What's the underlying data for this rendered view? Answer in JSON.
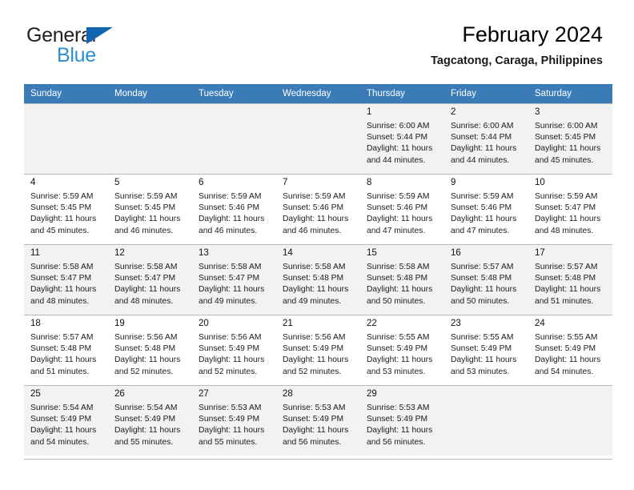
{
  "brand": {
    "name_top": "General",
    "name_bottom": "Blue",
    "triangle_color": "#1266b0",
    "bottom_text_color": "#2a8fd4"
  },
  "header": {
    "title": "February 2024",
    "location": "Tagcatong, Caraga, Philippines"
  },
  "theme": {
    "header_row_bg": "#3b7cb8",
    "header_row_text": "#ffffff",
    "shaded_row_bg": "#f2f2f2",
    "grid_line": "#b9b9b9"
  },
  "weekday_headers": [
    "Sunday",
    "Monday",
    "Tuesday",
    "Wednesday",
    "Thursday",
    "Friday",
    "Saturday"
  ],
  "weeks": [
    {
      "shaded": true,
      "days": [
        {
          "day": "",
          "lines": []
        },
        {
          "day": "",
          "lines": []
        },
        {
          "day": "",
          "lines": []
        },
        {
          "day": "",
          "lines": []
        },
        {
          "day": "1",
          "lines": [
            "Sunrise: 6:00 AM",
            "Sunset: 5:44 PM",
            "Daylight: 11 hours",
            "and 44 minutes."
          ]
        },
        {
          "day": "2",
          "lines": [
            "Sunrise: 6:00 AM",
            "Sunset: 5:44 PM",
            "Daylight: 11 hours",
            "and 44 minutes."
          ]
        },
        {
          "day": "3",
          "lines": [
            "Sunrise: 6:00 AM",
            "Sunset: 5:45 PM",
            "Daylight: 11 hours",
            "and 45 minutes."
          ]
        }
      ]
    },
    {
      "shaded": false,
      "days": [
        {
          "day": "4",
          "lines": [
            "Sunrise: 5:59 AM",
            "Sunset: 5:45 PM",
            "Daylight: 11 hours",
            "and 45 minutes."
          ]
        },
        {
          "day": "5",
          "lines": [
            "Sunrise: 5:59 AM",
            "Sunset: 5:45 PM",
            "Daylight: 11 hours",
            "and 46 minutes."
          ]
        },
        {
          "day": "6",
          "lines": [
            "Sunrise: 5:59 AM",
            "Sunset: 5:46 PM",
            "Daylight: 11 hours",
            "and 46 minutes."
          ]
        },
        {
          "day": "7",
          "lines": [
            "Sunrise: 5:59 AM",
            "Sunset: 5:46 PM",
            "Daylight: 11 hours",
            "and 46 minutes."
          ]
        },
        {
          "day": "8",
          "lines": [
            "Sunrise: 5:59 AM",
            "Sunset: 5:46 PM",
            "Daylight: 11 hours",
            "and 47 minutes."
          ]
        },
        {
          "day": "9",
          "lines": [
            "Sunrise: 5:59 AM",
            "Sunset: 5:46 PM",
            "Daylight: 11 hours",
            "and 47 minutes."
          ]
        },
        {
          "day": "10",
          "lines": [
            "Sunrise: 5:59 AM",
            "Sunset: 5:47 PM",
            "Daylight: 11 hours",
            "and 48 minutes."
          ]
        }
      ]
    },
    {
      "shaded": true,
      "days": [
        {
          "day": "11",
          "lines": [
            "Sunrise: 5:58 AM",
            "Sunset: 5:47 PM",
            "Daylight: 11 hours",
            "and 48 minutes."
          ]
        },
        {
          "day": "12",
          "lines": [
            "Sunrise: 5:58 AM",
            "Sunset: 5:47 PM",
            "Daylight: 11 hours",
            "and 48 minutes."
          ]
        },
        {
          "day": "13",
          "lines": [
            "Sunrise: 5:58 AM",
            "Sunset: 5:47 PM",
            "Daylight: 11 hours",
            "and 49 minutes."
          ]
        },
        {
          "day": "14",
          "lines": [
            "Sunrise: 5:58 AM",
            "Sunset: 5:48 PM",
            "Daylight: 11 hours",
            "and 49 minutes."
          ]
        },
        {
          "day": "15",
          "lines": [
            "Sunrise: 5:58 AM",
            "Sunset: 5:48 PM",
            "Daylight: 11 hours",
            "and 50 minutes."
          ]
        },
        {
          "day": "16",
          "lines": [
            "Sunrise: 5:57 AM",
            "Sunset: 5:48 PM",
            "Daylight: 11 hours",
            "and 50 minutes."
          ]
        },
        {
          "day": "17",
          "lines": [
            "Sunrise: 5:57 AM",
            "Sunset: 5:48 PM",
            "Daylight: 11 hours",
            "and 51 minutes."
          ]
        }
      ]
    },
    {
      "shaded": false,
      "days": [
        {
          "day": "18",
          "lines": [
            "Sunrise: 5:57 AM",
            "Sunset: 5:48 PM",
            "Daylight: 11 hours",
            "and 51 minutes."
          ]
        },
        {
          "day": "19",
          "lines": [
            "Sunrise: 5:56 AM",
            "Sunset: 5:48 PM",
            "Daylight: 11 hours",
            "and 52 minutes."
          ]
        },
        {
          "day": "20",
          "lines": [
            "Sunrise: 5:56 AM",
            "Sunset: 5:49 PM",
            "Daylight: 11 hours",
            "and 52 minutes."
          ]
        },
        {
          "day": "21",
          "lines": [
            "Sunrise: 5:56 AM",
            "Sunset: 5:49 PM",
            "Daylight: 11 hours",
            "and 52 minutes."
          ]
        },
        {
          "day": "22",
          "lines": [
            "Sunrise: 5:55 AM",
            "Sunset: 5:49 PM",
            "Daylight: 11 hours",
            "and 53 minutes."
          ]
        },
        {
          "day": "23",
          "lines": [
            "Sunrise: 5:55 AM",
            "Sunset: 5:49 PM",
            "Daylight: 11 hours",
            "and 53 minutes."
          ]
        },
        {
          "day": "24",
          "lines": [
            "Sunrise: 5:55 AM",
            "Sunset: 5:49 PM",
            "Daylight: 11 hours",
            "and 54 minutes."
          ]
        }
      ]
    },
    {
      "shaded": true,
      "days": [
        {
          "day": "25",
          "lines": [
            "Sunrise: 5:54 AM",
            "Sunset: 5:49 PM",
            "Daylight: 11 hours",
            "and 54 minutes."
          ]
        },
        {
          "day": "26",
          "lines": [
            "Sunrise: 5:54 AM",
            "Sunset: 5:49 PM",
            "Daylight: 11 hours",
            "and 55 minutes."
          ]
        },
        {
          "day": "27",
          "lines": [
            "Sunrise: 5:53 AM",
            "Sunset: 5:49 PM",
            "Daylight: 11 hours",
            "and 55 minutes."
          ]
        },
        {
          "day": "28",
          "lines": [
            "Sunrise: 5:53 AM",
            "Sunset: 5:49 PM",
            "Daylight: 11 hours",
            "and 56 minutes."
          ]
        },
        {
          "day": "29",
          "lines": [
            "Sunrise: 5:53 AM",
            "Sunset: 5:49 PM",
            "Daylight: 11 hours",
            "and 56 minutes."
          ]
        },
        {
          "day": "",
          "lines": []
        },
        {
          "day": "",
          "lines": []
        }
      ]
    }
  ]
}
